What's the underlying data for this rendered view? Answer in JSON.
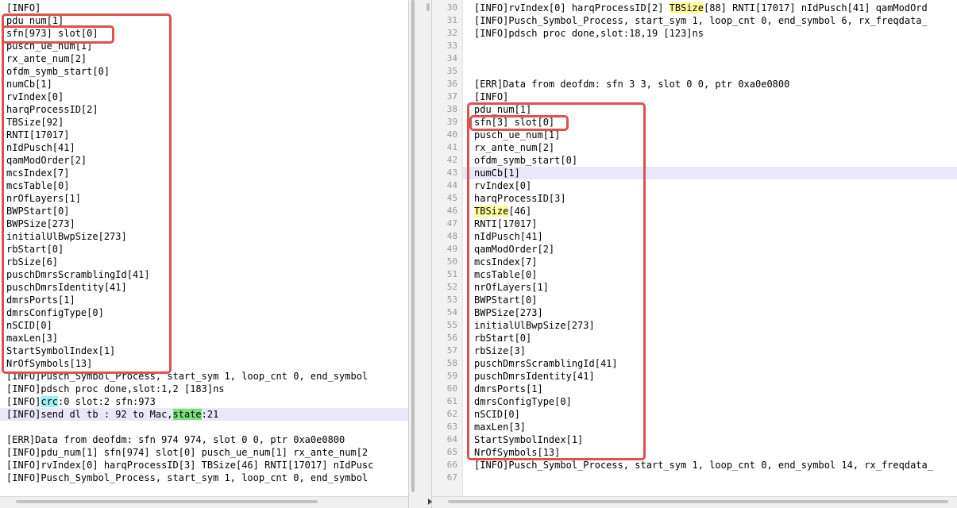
{
  "left": {
    "lines": [
      "[INFO]",
      "pdu_num[1]",
      "sfn[973] slot[0]",
      "pusch_ue_num[1]",
      "rx_ante_num[2]",
      "ofdm_symb_start[0]",
      "numCb[1]",
      "rvIndex[0]",
      "harqProcessID[2]",
      "TBSize[92]",
      "RNTI[17017]",
      "nIdPusch[41]",
      "qamModOrder[2]",
      "mcsIndex[7]",
      "mcsTable[0]",
      "nrOfLayers[1]",
      "BWPStart[0]",
      "BWPSize[273]",
      "initialUlBwpSize[273]",
      "rbStart[0]",
      "rbSize[6]",
      "puschDmrsScramblingId[41]",
      "puschDmrsIdentity[41]",
      "dmrsPorts[1]",
      "dmrsConfigType[0]",
      "nSCID[0]",
      "maxLen[3]",
      "StartSymbolIndex[1]",
      "NrOfSymbols[13]",
      "[INFO]Pusch_Symbol_Process, start_sym 1, loop_cnt 0, end_symbol",
      "[INFO]pdsch proc done,slot:1,2 [183]ns",
      "",
      "",
      "",
      "[ERR]Data from deofdm: sfn 974 974, slot 0 0, ptr 0xa0e0800",
      "[INFO]pdu_num[1] sfn[974] slot[0] pusch_ue_num[1] rx_ante_num[2",
      "[INFO]rvIndex[0] harqProcessID[3] TBSize[46] RNTI[17017] nIdPusc",
      "[INFO]Pusch_Symbol_Process, start_sym 1, loop_cnt 0, end_symbol"
    ],
    "crc_line": {
      "pre": "[INFO]",
      "hl": "crc",
      "post": ":0 slot:2 sfn:973"
    },
    "send_line": {
      "pre": "[INFO]send dl tb : 92 to Mac,",
      "hl": "state",
      "post": ":21"
    }
  },
  "right": {
    "rows": [
      {
        "n": "30",
        "t": "[INFO]rvIndex[0] harqProcessID[2] ",
        "hl": "TBSize",
        "t2": "[88] RNTI[17017] nIdPusch[41] qamModOrd"
      },
      {
        "n": "31",
        "t": "[INFO]Pusch_Symbol_Process, start_sym 1, loop_cnt 0, end_symbol 6, rx_freqdata_"
      },
      {
        "n": "32",
        "t": "[INFO]pdsch proc done,slot:18,19 [123]ns"
      },
      {
        "n": "33",
        "t": ""
      },
      {
        "n": "34",
        "t": ""
      },
      {
        "n": "35",
        "t": ""
      },
      {
        "n": "36",
        "t": "[ERR]Data from deofdm: sfn 3 3, slot 0 0, ptr 0xa0e0800"
      },
      {
        "n": "37",
        "t": "[INFO]"
      },
      {
        "n": "38",
        "t": "pdu_num[1]"
      },
      {
        "n": "39",
        "t": "sfn[3] slot[0]"
      },
      {
        "n": "40",
        "t": "pusch_ue_num[1]"
      },
      {
        "n": "41",
        "t": "rx_ante_num[2]"
      },
      {
        "n": "42",
        "t": "ofdm_symb_start[0]"
      },
      {
        "n": "43",
        "t": "numCb[1]"
      },
      {
        "n": "44",
        "t": "rvIndex[0]"
      },
      {
        "n": "45",
        "t": "harqProcessID[3]"
      },
      {
        "n": "46",
        "t": "",
        "hl": "TBSize",
        "t2": "[46]"
      },
      {
        "n": "47",
        "t": "RNTI[17017]"
      },
      {
        "n": "48",
        "t": "nIdPusch[41]"
      },
      {
        "n": "49",
        "t": "qamModOrder[2]"
      },
      {
        "n": "50",
        "t": "mcsIndex[7]"
      },
      {
        "n": "51",
        "t": "mcsTable[0]"
      },
      {
        "n": "52",
        "t": "nrOfLayers[1]"
      },
      {
        "n": "53",
        "t": "BWPStart[0]"
      },
      {
        "n": "54",
        "t": "BWPSize[273]"
      },
      {
        "n": "55",
        "t": "initialUlBwpSize[273]"
      },
      {
        "n": "56",
        "t": "rbStart[0]"
      },
      {
        "n": "57",
        "t": "rbSize[3]"
      },
      {
        "n": "58",
        "t": "puschDmrsScramblingId[41]"
      },
      {
        "n": "59",
        "t": "puschDmrsIdentity[41]"
      },
      {
        "n": "60",
        "t": "dmrsPorts[1]"
      },
      {
        "n": "61",
        "t": "dmrsConfigType[0]"
      },
      {
        "n": "62",
        "t": "nSCID[0]"
      },
      {
        "n": "63",
        "t": "maxLen[3]"
      },
      {
        "n": "64",
        "t": "StartSymbolIndex[1]"
      },
      {
        "n": "65",
        "t": "NrOfSymbols[13]"
      },
      {
        "n": "66",
        "t": "[INFO]Pusch_Symbol_Process, start_sym 1, loop_cnt 0, end_symbol 14, rx_freqdata_"
      },
      {
        "n": "67",
        "t": ""
      }
    ]
  },
  "colors": {
    "annotation_box": "#e05050",
    "current_line": "#e8e8f8",
    "find_highlight": "#ffff99",
    "crc_highlight": "#9ff0f0",
    "state_highlight": "#7be37b"
  }
}
